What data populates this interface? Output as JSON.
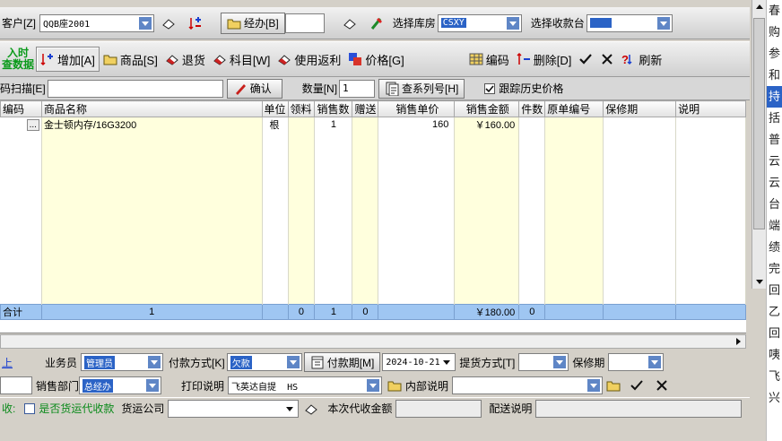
{
  "top": {
    "customer_label": "客户[Z]",
    "customer_value": "QQB座2001",
    "handler_label": "经办[B]",
    "handler_value": "",
    "warehouse_label": "选择库房",
    "warehouse_value": "CSXY",
    "cashier_label": "选择收款台",
    "cashier_value": ""
  },
  "toolbar": {
    "realtime_label_1": "入时",
    "realtime_label_2": "查数据",
    "add": "增加[A]",
    "goods": "商品[S]",
    "return": "退货",
    "subject": "科目[W]",
    "rebate": "使用返利",
    "price": "价格[G]",
    "code": "编码",
    "delete": "删除[D]",
    "refresh": "刷新"
  },
  "scan": {
    "label": "码扫描[E]",
    "value": "",
    "confirm": "确认",
    "qty_label": "数量[N]",
    "qty_value": "1",
    "serial_btn": "查系列号[H]",
    "history_label": "跟踪历史价格"
  },
  "grid": {
    "columns": [
      "编码",
      "商品名称",
      "单位",
      "领料",
      "销售数",
      "赠送",
      "销售单价",
      "销售金额",
      "件数",
      "原单编号",
      "保修期",
      "说明"
    ],
    "rows": [
      {
        "code": "...",
        "name": "金士顿内存/16G3200",
        "unit": "根",
        "pick": "",
        "qty": "1",
        "gift": "",
        "price": "160",
        "amount": "￥160.00",
        "pieces": "",
        "orig_no": "",
        "warranty": "",
        "note": ""
      }
    ],
    "totals": {
      "label": "合计",
      "rows": "1",
      "pick": "0",
      "qty": "1",
      "gift": "0",
      "amount": "￥180.00",
      "pieces": "0"
    }
  },
  "bottom": {
    "salesman_label": "业务员",
    "salesman_value": "管理员",
    "paymethod_label": "付款方式[K]",
    "paymethod_value": "欠款",
    "payterm_btn": "付款期[M]",
    "date_value": "2024-10-21",
    "pickup_label": "提货方式[T]",
    "pickup_value": "",
    "warranty_label": "保修期",
    "warranty_value": "",
    "dept_label": "销售部门",
    "dept_value": "总经办",
    "print_label": "打印说明",
    "print_value": "飞英达自提  HS",
    "internal_label": "内部说明",
    "internal_value": "",
    "left_link": "上",
    "receive_label": "收:",
    "freight_label": "是否货运代收款",
    "shipco_label": "货运公司",
    "shipco_value": "",
    "collect_label": "本次代收金额",
    "collect_value": "",
    "delivery_label": "配送说明",
    "delivery_value": ""
  },
  "right_strip": [
    "春",
    "购",
    "参",
    "和",
    "持",
    "括",
    "普",
    "云",
    "云",
    "台",
    "端",
    "绩",
    "完",
    "回",
    "乙",
    "回",
    "咦",
    "飞",
    "兴"
  ]
}
